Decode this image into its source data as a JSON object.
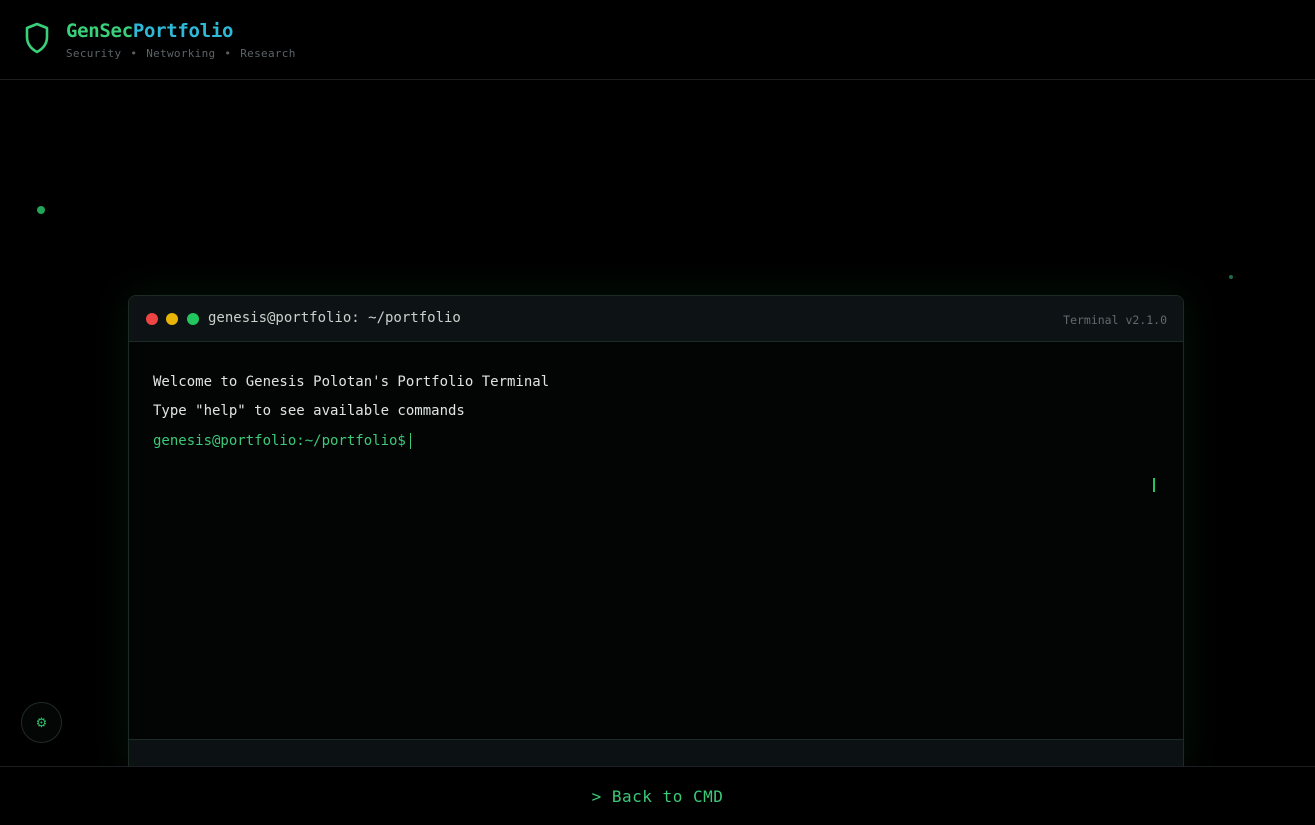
{
  "header": {
    "brand_part1": "GenSec",
    "brand_part2": "Portfolio",
    "subtitle": [
      "Security",
      "Networking",
      "Research"
    ],
    "logo_icon": "shield-icon"
  },
  "terminal": {
    "path_title": "genesis@portfolio: ~/portfolio",
    "version": "Terminal v2.1.0",
    "lines": [
      "Welcome to Genesis Polotan's Portfolio Terminal",
      "Type \"help\" to see available commands"
    ],
    "prompt": "genesis@portfolio:~/portfolio$",
    "input_value": ""
  },
  "settings": {
    "icon": "gear-icon"
  },
  "footer": {
    "back_label": "> Back to CMD"
  },
  "colors": {
    "accent_green": "#3cc978",
    "accent_cyan": "#2fb9d8",
    "background": "#000000"
  }
}
